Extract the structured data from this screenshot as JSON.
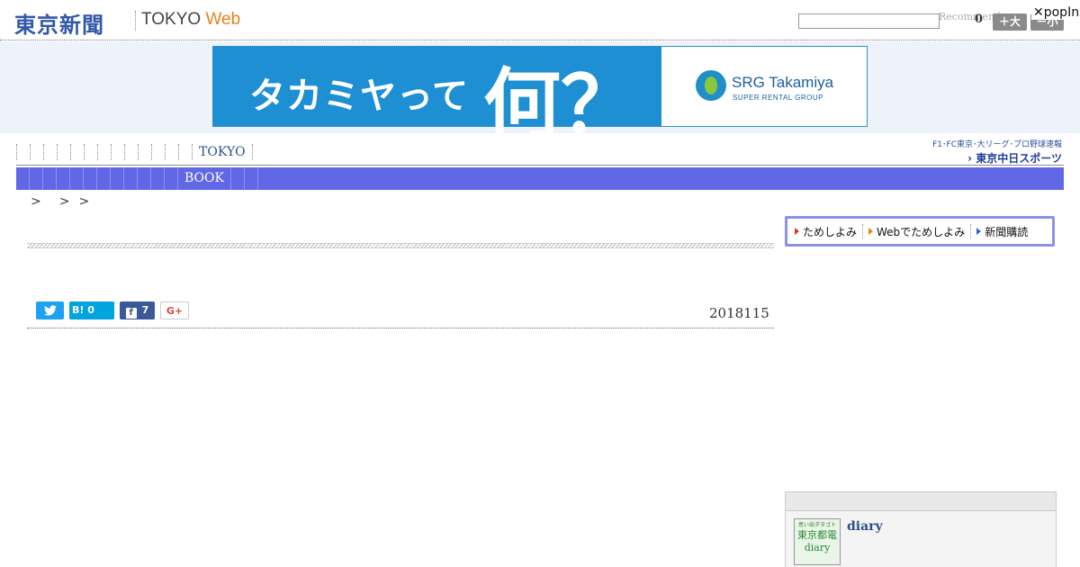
{
  "header": {
    "logo_jp": "東京新聞",
    "logo_en_main": "TOKYO ",
    "logo_en_web": "Web",
    "search_placeholder": "",
    "recommend_label": "Recommend",
    "recommend_count": "0",
    "font_big_label": "＋大",
    "font_small_label": "－小",
    "popin_label": "✕popIn"
  },
  "ad": {
    "copy": "タカミヤって",
    "what": "何？",
    "brand": "SRG Takamiya",
    "sub": "SUPER RENTAL GROUP"
  },
  "nav_primary": {
    "items": [
      "",
      "",
      "",
      "",
      "",
      "",
      "",
      "",
      "",
      "",
      "",
      "",
      "",
      "TOKYO",
      ""
    ]
  },
  "sports_banner": {
    "top": "F1･FC東京･大リーグ･プロ野球速報",
    "name": "› 東京中日スポーツ"
  },
  "nav_secondary": {
    "items": [
      "",
      "",
      "",
      "",
      "",
      "",
      "",
      "",
      "",
      "",
      "",
      "",
      "BOOK",
      "",
      ""
    ]
  },
  "breadcrumb": {
    "items": [
      ">",
      "",
      ">",
      ">"
    ]
  },
  "subscribe": {
    "items": [
      "ためしよみ",
      "Webでためしよみ",
      "新聞購読"
    ]
  },
  "share": {
    "twitter": "",
    "hatena": "B! 0",
    "facebook": "7",
    "gplus": "G+"
  },
  "article": {
    "date": "2018115"
  },
  "sidebar": {
    "diary_thumb_top": "思い出ダタゴト",
    "diary_thumb_main": "東京都電",
    "diary_thumb_sub": "diary",
    "diary_link": "diary"
  },
  "colors": {
    "accent_blue": "#6168e6",
    "logo_blue": "#3158a8",
    "web_orange": "#e8821c"
  }
}
